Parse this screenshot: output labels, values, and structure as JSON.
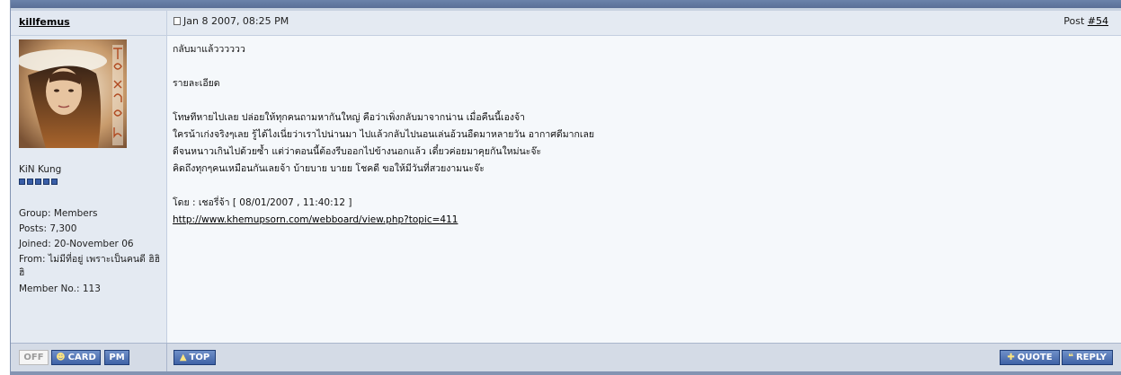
{
  "post": {
    "username": "killfemus",
    "date": "Jan 8 2007, 08:25 PM",
    "post_label": "Post ",
    "post_number": "#54"
  },
  "user": {
    "rank_name": "KiN Kung",
    "rank_pips": 5,
    "group": "Group: Members",
    "posts": "Posts: 7,300",
    "joined": "Joined: 20-November 06",
    "from": "From: ไม่มีที่อยู่ เพราะเป็นคนดี ฮิฮิฮิ",
    "member_no": "Member No.: 113"
  },
  "content": {
    "line1": "กลับมาแล้วววววว",
    "line2": "รายละเอียด",
    "line3": "โทษทีหายไปเลย ปล่อยให้ทุกคนถามหากันใหญ่ คือว่าเพิ่งกลับมาจากน่าน เมื่อคืนนี้เองจ้า",
    "line4": "ใครน้าเก่งจริงๆเลย รู้ได้ไงเนี่ยว่าเราไปน่านมา ไปแล้วกลับไปนอนเล่นอ้วนอืดมาหลายวัน อากาศดีมากเลย",
    "line5": "ดีจนหนาวเกินไปด้วยซ้ำ แต่ว่าตอนนี้ต้องรีบออกไปข้างนอกแล้ว เดี๋ยวค่อยมาคุยกันใหม่นะจ๊ะ",
    "line6": "คิดถึงทุกๆคนเหมือนกันเลยจ้า บ้ายบาย บายย โชคดี ขอให้มีวันที่สวยงามนะจ๊ะ",
    "byline": "โดย : เชอรี่จ้า [ 08/01/2007 , 11:40:12 ]",
    "link": "http://www.khemupsorn.com/webboard/view.php?topic=411"
  },
  "buttons": {
    "off": "OFF",
    "card": "CARD",
    "pm": "PM",
    "top": "TOP",
    "quote": "QUOTE",
    "reply": "REPLY"
  },
  "colors": {
    "accent": "#3f62a6",
    "header_bg": "#e4eaf2",
    "footer_bg": "#d4dbe6"
  },
  "icons": {
    "card": "user-icon",
    "top": "arrow-up-icon",
    "quote": "plus-icon",
    "reply": "quote-icon",
    "date": "post-icon"
  }
}
